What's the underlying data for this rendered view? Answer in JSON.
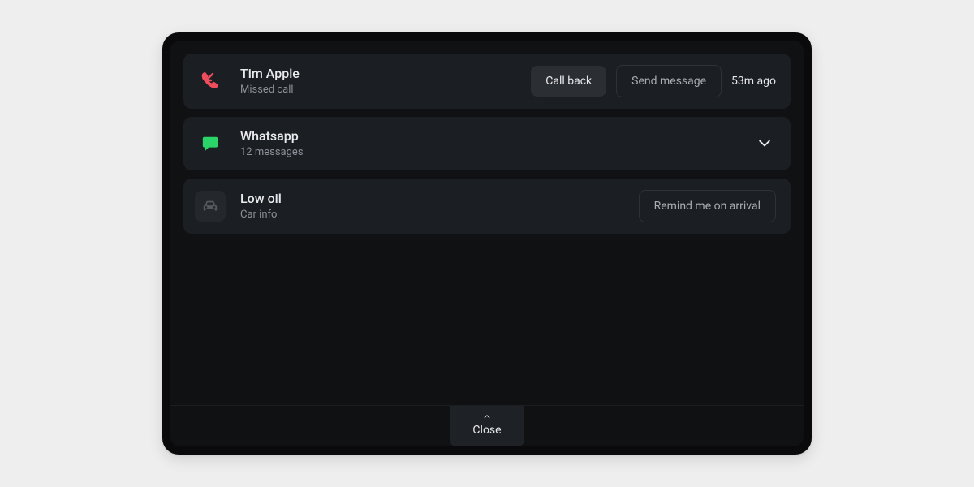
{
  "notifications": [
    {
      "icon": "missed-call-icon",
      "title": "Tim Apple",
      "subtitle": "Missed call",
      "primary_action": "Call back",
      "secondary_action": "Send message",
      "timestamp": "53m ago"
    },
    {
      "icon": "whatsapp-icon",
      "title": "Whatsapp",
      "subtitle": "12 messages"
    },
    {
      "icon": "car-icon",
      "title": "Low oil",
      "subtitle": "Car info",
      "secondary_action": "Remind me on arrival"
    }
  ],
  "close_label": "Close",
  "colors": {
    "missed_call": "#ef4c5c",
    "whatsapp": "#2bd469",
    "car": "#55595f"
  }
}
